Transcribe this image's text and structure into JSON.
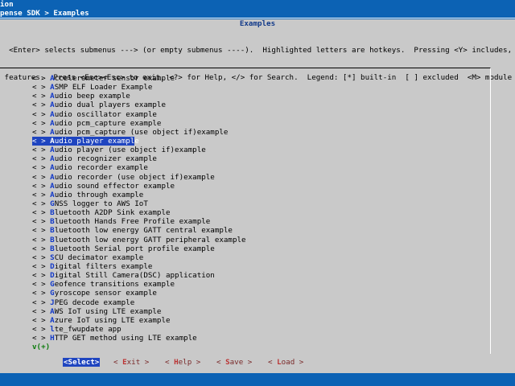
{
  "window": {
    "title": "ion",
    "breadcrumb": "pense SDK > Examples"
  },
  "dialog": {
    "title": "Examples",
    "help_lines": [
      "  <Enter> selects submenus ---> (or empty submenus ----).  Highlighted letters are hotkeys.  Pressing <Y> includes,",
      " features.  Press <Esc><Esc> to exit, <?> for Help, </> for Search.  Legend: [*] built-in  [ ] excluded  <M> module"
    ]
  },
  "menu": {
    "prefix": "< > ",
    "items": [
      {
        "hotkey": "A",
        "rest": "ccelerometer sensor example"
      },
      {
        "hotkey": "A",
        "rest": "SMP ELF Loader Example"
      },
      {
        "hotkey": "A",
        "rest": "udio beep example"
      },
      {
        "hotkey": "A",
        "rest": "udio dual players example"
      },
      {
        "hotkey": "A",
        "rest": "udio oscillator example"
      },
      {
        "hotkey": "A",
        "rest": "udio pcm_capture example"
      },
      {
        "hotkey": "A",
        "rest": "udio pcm_capture (use object if)example"
      },
      {
        "hotkey": "A",
        "rest": "udio player example",
        "selected": true
      },
      {
        "hotkey": "A",
        "rest": "udio player (use object if)example"
      },
      {
        "hotkey": "A",
        "rest": "udio recognizer example"
      },
      {
        "hotkey": "A",
        "rest": "udio recorder example"
      },
      {
        "hotkey": "A",
        "rest": "udio recorder (use object if)example"
      },
      {
        "hotkey": "A",
        "rest": "udio sound effector example"
      },
      {
        "hotkey": "A",
        "rest": "udio through example"
      },
      {
        "hotkey": "G",
        "rest": "NSS logger to AWS IoT"
      },
      {
        "hotkey": "B",
        "rest": "luetooth A2DP Sink example"
      },
      {
        "hotkey": "B",
        "rest": "luetooth Hands Free Profile example"
      },
      {
        "hotkey": "B",
        "rest": "luetooth low energy GATT central example"
      },
      {
        "hotkey": "B",
        "rest": "luetooth low energy GATT peripheral example"
      },
      {
        "hotkey": "B",
        "rest": "luetooth Serial port profile example"
      },
      {
        "hotkey": "S",
        "rest": "CU decimator example"
      },
      {
        "hotkey": "D",
        "rest": "igital filters example"
      },
      {
        "hotkey": "D",
        "rest": "igital Still Camera(DSC) application"
      },
      {
        "hotkey": "G",
        "rest": "eofence transitions example"
      },
      {
        "hotkey": "G",
        "rest": "yroscope sensor example"
      },
      {
        "hotkey": "J",
        "rest": "PEG decode example"
      },
      {
        "hotkey": "A",
        "rest": "WS IoT using LTE example"
      },
      {
        "hotkey": "A",
        "rest": "zure IoT using LTE example"
      },
      {
        "hotkey": "l",
        "rest": "te_fwupdate app"
      },
      {
        "hotkey": "H",
        "rest": "TTP GET method using LTE example"
      }
    ],
    "more_indicator": "v(+)"
  },
  "buttons": [
    {
      "name": "select-button",
      "open": "<",
      "hotkey": "S",
      "rest": "elect",
      "close": ">",
      "selected": true
    },
    {
      "name": "exit-button",
      "open": "< ",
      "hotkey": "E",
      "rest": "xit",
      "close": " >"
    },
    {
      "name": "help-button",
      "open": "< ",
      "hotkey": "H",
      "rest": "elp",
      "close": " >"
    },
    {
      "name": "save-button",
      "open": "< ",
      "hotkey": "S",
      "rest": "ave",
      "close": " >"
    },
    {
      "name": "load-button",
      "open": "< ",
      "hotkey": "L",
      "rest": "oad",
      "close": " >"
    }
  ],
  "colors": {
    "background": "#0c62b4",
    "dialog": "#c9c9c9",
    "highlight": "#1f45c0",
    "hotkey": "#1239c8"
  }
}
